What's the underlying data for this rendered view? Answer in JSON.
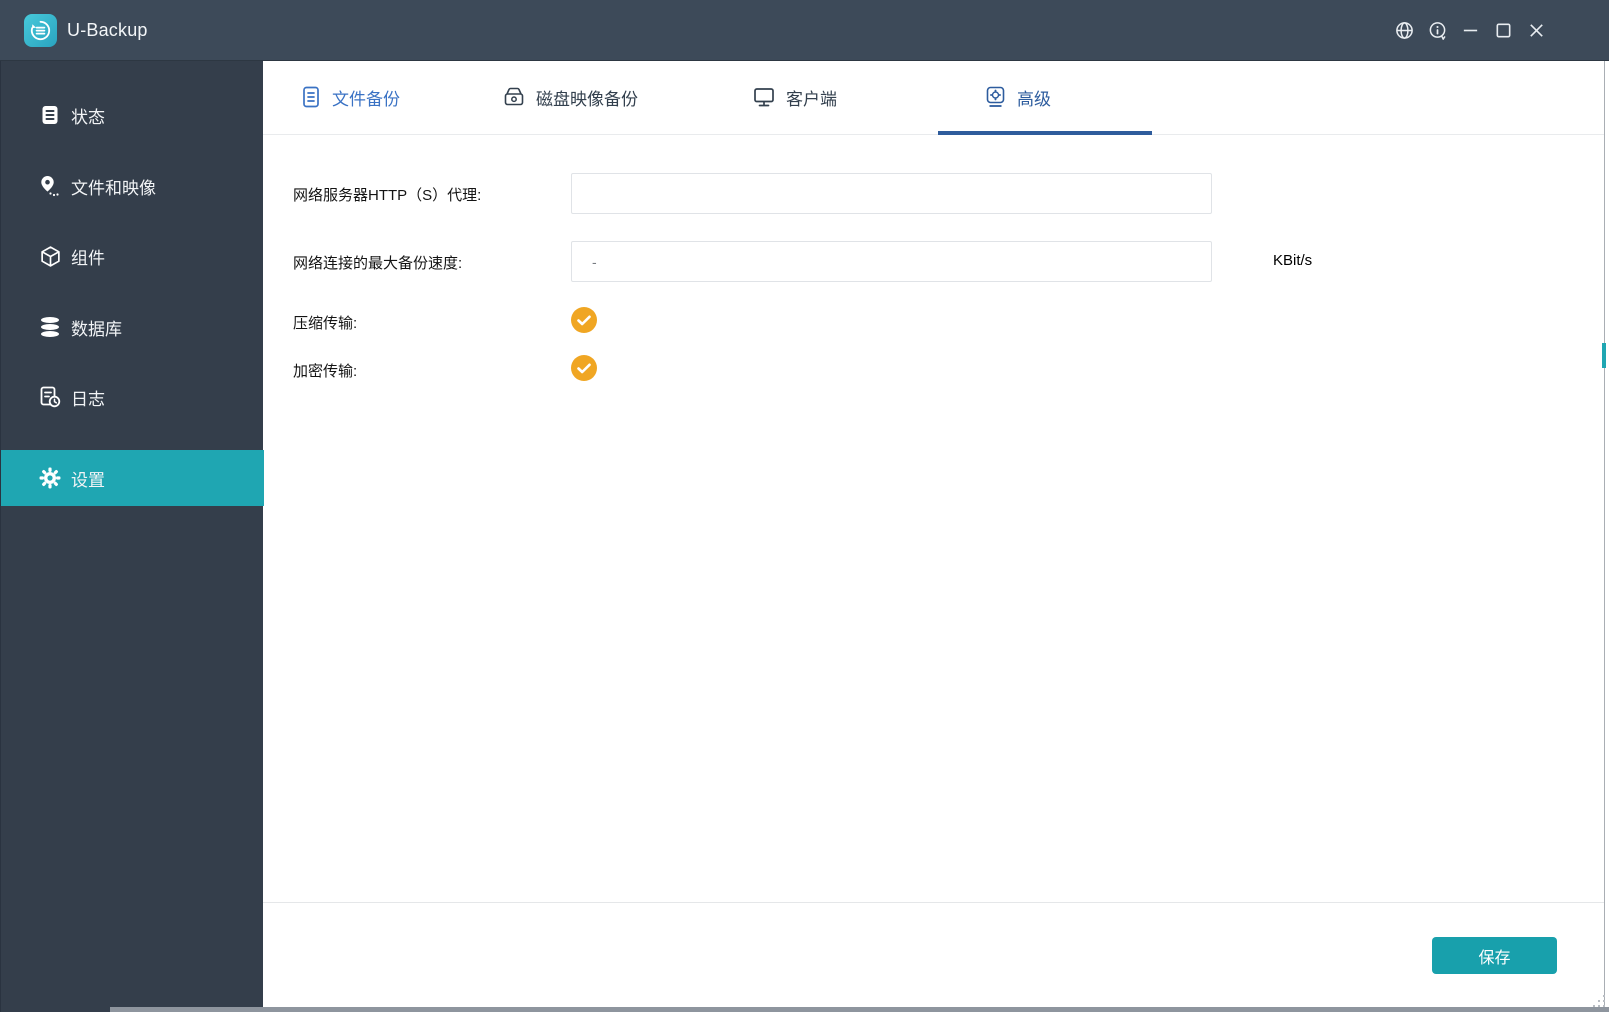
{
  "app": {
    "title": "U-Backup"
  },
  "titlebar": {
    "controls": {
      "language": "globe",
      "about": "info",
      "minimize": "minimize",
      "maximize": "maximize",
      "close": "close"
    }
  },
  "sidebar": {
    "items": [
      {
        "label": "状态",
        "icon": "status-document-icon",
        "active": false
      },
      {
        "label": "文件和映像",
        "icon": "location-pin-icon",
        "active": false
      },
      {
        "label": "组件",
        "icon": "cube-icon",
        "active": false
      },
      {
        "label": "数据库",
        "icon": "database-icon",
        "active": false
      },
      {
        "label": "日志",
        "icon": "log-clock-icon",
        "active": false
      },
      {
        "label": "设置",
        "icon": "gear-icon",
        "active": true
      }
    ]
  },
  "tabs": [
    {
      "label": "文件备份",
      "icon": "file-backup-icon",
      "active": false
    },
    {
      "label": "磁盘映像备份",
      "icon": "disk-image-icon",
      "active": false
    },
    {
      "label": "客户端",
      "icon": "client-monitor-icon",
      "active": false
    },
    {
      "label": "高级",
      "icon": "advanced-gear-icon",
      "active": true
    }
  ],
  "form": {
    "proxy_label": "网络服务器HTTP（S）代理:",
    "proxy_value": "",
    "speed_label": "网络连接的最大备份速度:",
    "speed_value": "-",
    "speed_unit": "KBit/s",
    "compress_label": "压缩传输:",
    "compress_checked": true,
    "encrypt_label": "加密传输:",
    "encrypt_checked": true
  },
  "footer": {
    "save_label": "保存"
  },
  "colors": {
    "titlebar": "#3d4a59",
    "sidebar": "#343e4b",
    "sidebar_active": "#1fa6b2",
    "tab_active_blue": "#2d5c9e",
    "tab_file_blue": "#3a72c4",
    "check_orange": "#f0a623",
    "save_button": "#18a0ac"
  }
}
